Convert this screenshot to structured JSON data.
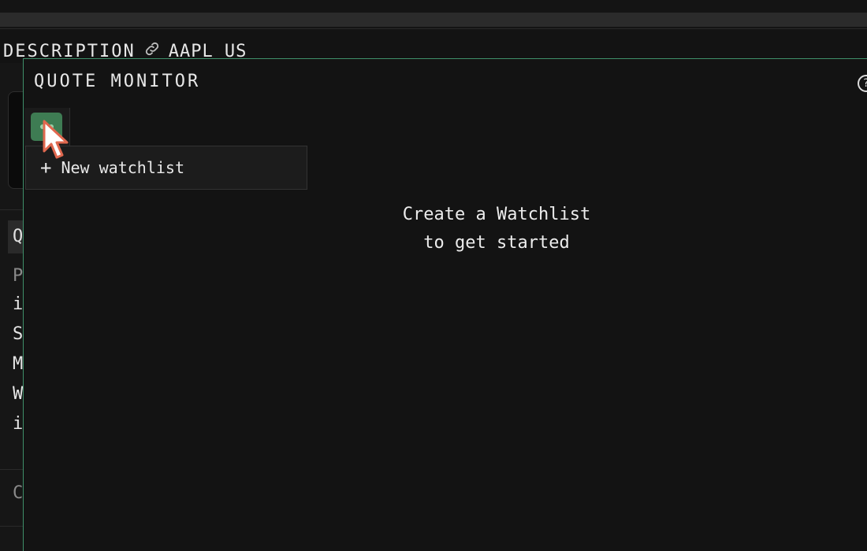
{
  "header": {
    "label": "DESCRIPTION",
    "link_icon": "link-icon",
    "ticker": "AAPL US"
  },
  "background_panel": {
    "letters": [
      "Q",
      "P",
      "i",
      "S",
      "M",
      "W",
      "i",
      "C"
    ]
  },
  "quote_monitor": {
    "title": "QUOTE MONITOR",
    "help_symbol": "?",
    "menu_trigger_icon": "more-dots-icon",
    "dropdown": {
      "items": [
        {
          "icon": "plus-icon",
          "symbol": "+",
          "label": "New watchlist"
        }
      ]
    },
    "empty_state": {
      "line1": "Create a Watchlist",
      "line2": "to get started"
    }
  },
  "colors": {
    "accent_green": "#3e7c53",
    "panel_border": "#3f8f6a",
    "background": "#131313"
  }
}
